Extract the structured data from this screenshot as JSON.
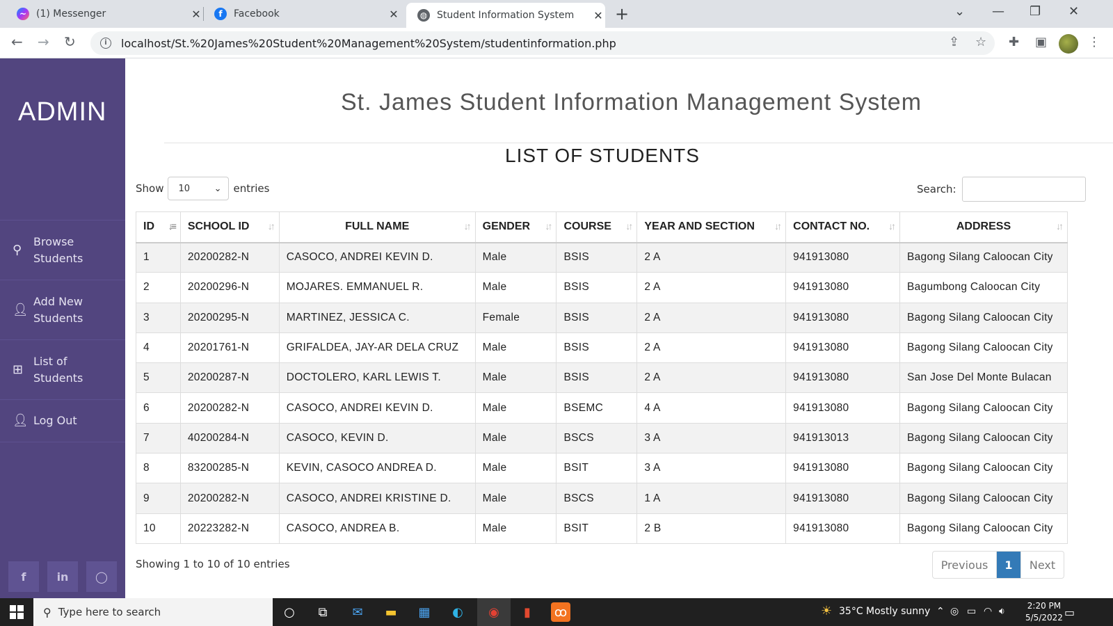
{
  "browser": {
    "tabs": [
      {
        "title": "(1) Messenger",
        "icon": "messenger-icon"
      },
      {
        "title": "Facebook",
        "icon": "facebook-icon"
      },
      {
        "title": "Student Information System",
        "icon": "globe-icon"
      }
    ],
    "address": "localhost/St.%20James%20Student%20Management%20System/studentinformation.php"
  },
  "sidebar": {
    "brand": "ADMIN",
    "items": [
      {
        "label": "Browse Students",
        "icon": "search-icon"
      },
      {
        "label": "Add New Students",
        "icon": "user-icon"
      },
      {
        "label": "List of Students",
        "icon": "table-icon"
      },
      {
        "label": "Log Out",
        "icon": "user-icon"
      }
    ],
    "socials": [
      "facebook-icon",
      "linkedin-icon",
      "github-icon"
    ]
  },
  "page": {
    "title": "St. James Student Information Management System",
    "list_title": "LIST OF STUDENTS",
    "show_label": "Show",
    "entries_value": "10",
    "entries_label": "entries",
    "search_label": "Search:",
    "search_value": ""
  },
  "table": {
    "columns": [
      "ID",
      "SCHOOL ID",
      "FULL NAME",
      "GENDER",
      "COURSE",
      "YEAR AND SECTION",
      "CONTACT NO.",
      "ADDRESS"
    ],
    "rows": [
      [
        "1",
        "20200282-N",
        "CASOCO, ANDREI KEVIN D.",
        "Male",
        "BSIS",
        "2 A",
        "941913080",
        "Bagong Silang Caloocan City"
      ],
      [
        "2",
        "20200296-N",
        "MOJARES. EMMANUEL R.",
        "Male",
        "BSIS",
        "2 A",
        "941913080",
        "Bagumbong Caloocan City"
      ],
      [
        "3",
        "20200295-N",
        "MARTINEZ, JESSICA C.",
        "Female",
        "BSIS",
        "2 A",
        "941913080",
        "Bagong Silang Caloocan City"
      ],
      [
        "4",
        "20201761-N",
        "GRIFALDEA, JAY-AR DELA CRUZ",
        "Male",
        "BSIS",
        "2 A",
        "941913080",
        "Bagong Silang Caloocan City"
      ],
      [
        "5",
        "20200287-N",
        "DOCTOLERO, KARL LEWIS T.",
        "Male",
        "BSIS",
        "2 A",
        "941913080",
        "San Jose Del Monte Bulacan"
      ],
      [
        "6",
        "20200282-N",
        "CASOCO, ANDREI KEVIN D.",
        "Male",
        "BSEMC",
        "4 A",
        "941913080",
        "Bagong Silang Caloocan City"
      ],
      [
        "7",
        "40200284-N",
        "CASOCO, KEVIN D.",
        "Male",
        "BSCS",
        "3 A",
        "941913013",
        "Bagong Silang Caloocan City"
      ],
      [
        "8",
        "83200285-N",
        "KEVIN, CASOCO ANDREA D.",
        "Male",
        "BSIT",
        "3 A",
        "941913080",
        "Bagong Silang Caloocan City"
      ],
      [
        "9",
        "20200282-N",
        "CASOCO, ANDREI KRISTINE D.",
        "Male",
        "BSCS",
        "1 A",
        "941913080",
        "Bagong Silang Caloocan City"
      ],
      [
        "10",
        "20223282-N",
        "CASOCO, ANDREA B.",
        "Male",
        "BSIT",
        "2 B",
        "941913080",
        "Bagong Silang Caloocan City"
      ]
    ],
    "info": "Showing 1 to 10 of 10 entries",
    "pager": {
      "previous": "Previous",
      "current": "1",
      "next": "Next"
    }
  },
  "taskbar": {
    "search_placeholder": "Type here to search",
    "weather": "35°C  Mostly sunny",
    "time": "2:20 PM",
    "date": "5/5/2022"
  }
}
